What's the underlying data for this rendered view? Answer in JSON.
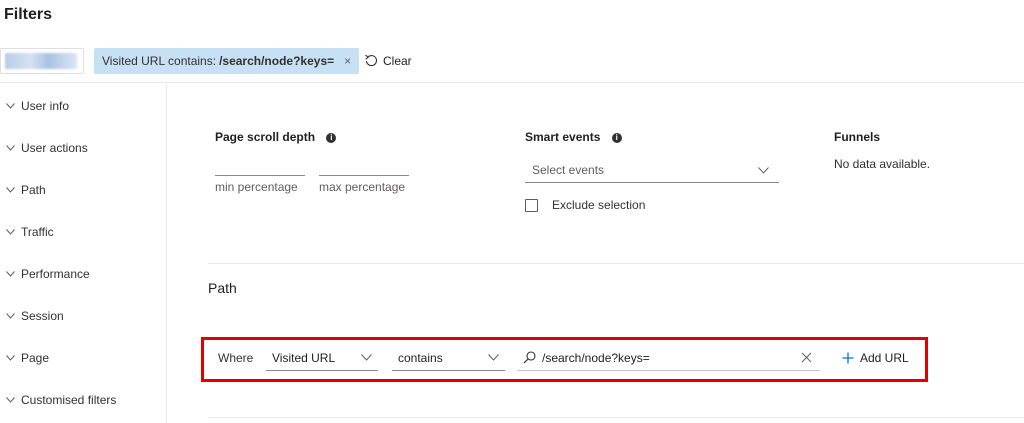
{
  "page": {
    "title": "Filters"
  },
  "filter_bar": {
    "chip_prefix": "Visited URL contains:",
    "chip_value": "/search/node?keys=",
    "chip_remove": "×",
    "clear_label": "Clear"
  },
  "sidebar": {
    "items": [
      {
        "label": "User info"
      },
      {
        "label": "User actions"
      },
      {
        "label": "Path"
      },
      {
        "label": "Traffic"
      },
      {
        "label": "Performance"
      },
      {
        "label": "Session"
      },
      {
        "label": "Page"
      },
      {
        "label": "Customised filters"
      }
    ]
  },
  "user_actions": {
    "scroll_depth": {
      "title": "Page scroll depth",
      "min_value": "",
      "max_value": "",
      "min_label": "min percentage",
      "max_label": "max percentage"
    },
    "smart_events": {
      "title": "Smart events",
      "placeholder": "Select events",
      "exclude_label": "Exclude selection"
    },
    "funnels": {
      "title": "Funnels",
      "empty_text": "No data available."
    }
  },
  "path": {
    "title": "Path",
    "where_label": "Where",
    "field_selected": "Visited URL",
    "operator_selected": "contains",
    "url_value": "/search/node?keys=",
    "add_url_label": "Add URL"
  },
  "colors": {
    "chip_bg": "#c7e0f4",
    "highlight_border": "#e00000",
    "accent": "#0078d4"
  },
  "icons": {
    "info": "info-icon",
    "chevron": "chevron-down-icon",
    "search": "search-icon",
    "clear": "undo-icon",
    "add": "plus-icon",
    "close": "close-icon"
  }
}
